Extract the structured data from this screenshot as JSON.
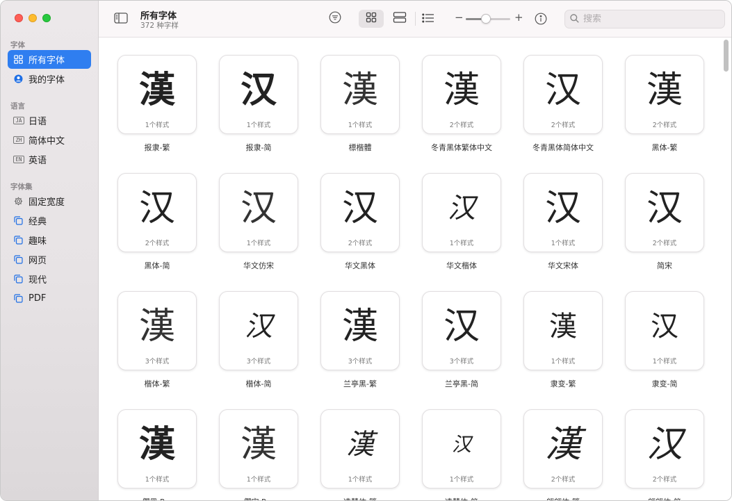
{
  "sidebar": {
    "section_fonts": "字体",
    "section_language": "语言",
    "section_collections": "字体集",
    "items_fonts": [
      {
        "label": "所有字体",
        "icon": "grid-icon",
        "active": true
      },
      {
        "label": "我的字体",
        "icon": "person-circle-icon",
        "active": false
      }
    ],
    "items_language": [
      {
        "badge": "JA",
        "label": "日语"
      },
      {
        "badge": "ZH",
        "label": "简体中文"
      },
      {
        "badge": "EN",
        "label": "英语"
      }
    ],
    "items_collections": [
      {
        "label": "固定宽度",
        "icon": "gear-icon"
      },
      {
        "label": "经典",
        "icon": "collection-icon"
      },
      {
        "label": "趣味",
        "icon": "collection-icon"
      },
      {
        "label": "网页",
        "icon": "collection-icon"
      },
      {
        "label": "现代",
        "icon": "collection-icon"
      },
      {
        "label": "PDF",
        "icon": "collection-icon"
      }
    ]
  },
  "toolbar": {
    "title": "所有字体",
    "subtitle": "372 种字样",
    "search_placeholder": "搜索",
    "zoom_level": 0.45,
    "view_mode": "grid"
  },
  "colors": {
    "accent": "#2f7ef0",
    "sidebar_bg": "#e9e5e7"
  },
  "fonts": [
    {
      "glyph": "漢",
      "styles": "1个样式",
      "name": "报隶-繁",
      "look": "g-bold"
    },
    {
      "glyph": "汉",
      "styles": "1个样式",
      "name": "报隶-简",
      "look": "g-bold"
    },
    {
      "glyph": "漢",
      "styles": "1个样式",
      "name": "標楷體",
      "look": "g-thin"
    },
    {
      "glyph": "漢",
      "styles": "2个样式",
      "name": "冬青黑体繁体中文",
      "look": "g-sans"
    },
    {
      "glyph": "汉",
      "styles": "2个样式",
      "name": "冬青黑体简体中文",
      "look": "g-sans"
    },
    {
      "glyph": "漢",
      "styles": "2个样式",
      "name": "黑体-繁",
      "look": "g-sans"
    },
    {
      "glyph": "汉",
      "styles": "2个样式",
      "name": "黑体-简",
      "look": "g-sans"
    },
    {
      "glyph": "汉",
      "styles": "1个样式",
      "name": "华文仿宋",
      "look": "g-thin"
    },
    {
      "glyph": "汉",
      "styles": "2个样式",
      "name": "华文黑体",
      "look": "g-sans"
    },
    {
      "glyph": "汉",
      "styles": "1个样式",
      "name": "华文楷体",
      "look": "g-italic g-small"
    },
    {
      "glyph": "汉",
      "styles": "1个样式",
      "name": "华文宋体",
      "look": "g-serif"
    },
    {
      "glyph": "汉",
      "styles": "2个样式",
      "name": "简宋",
      "look": "g-serif"
    },
    {
      "glyph": "漢",
      "styles": "3个样式",
      "name": "楷体-繁",
      "look": "g-thin"
    },
    {
      "glyph": "汉",
      "styles": "3个样式",
      "name": "楷体-简",
      "look": "g-italic g-small"
    },
    {
      "glyph": "漢",
      "styles": "3个样式",
      "name": "兰亭黑-繁",
      "look": "g-sans"
    },
    {
      "glyph": "汉",
      "styles": "3个样式",
      "name": "兰亭黑-简",
      "look": "g-sans"
    },
    {
      "glyph": "漢",
      "styles": "1个样式",
      "name": "隶变-繁",
      "look": "g-serif g-small"
    },
    {
      "glyph": "汉",
      "styles": "1个样式",
      "name": "隶变-简",
      "look": "g-serif g-small"
    },
    {
      "glyph": "漢",
      "styles": "1个样式",
      "name": "儷黑 Pro",
      "look": "g-bold"
    },
    {
      "glyph": "漢",
      "styles": "1个样式",
      "name": "儷宋 Pro",
      "look": "g-thin"
    },
    {
      "glyph": "漢",
      "styles": "1个样式",
      "name": "凌慧体-繁",
      "look": "g-italic g-small"
    },
    {
      "glyph": "汉",
      "styles": "1个样式",
      "name": "凌慧体-简",
      "look": "g-italic g-tiny"
    },
    {
      "glyph": "漢",
      "styles": "2个样式",
      "name": "翩翩体-繁",
      "look": "g-italic"
    },
    {
      "glyph": "汉",
      "styles": "2个样式",
      "name": "翩翩体-简",
      "look": "g-italic"
    }
  ]
}
